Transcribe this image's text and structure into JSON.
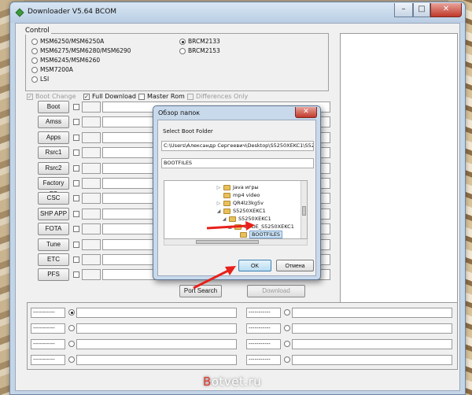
{
  "window": {
    "title": "Downloader V5.64 BCOM",
    "buttons": {
      "minimize": "–",
      "maximize": "□",
      "close": "✕"
    }
  },
  "control": {
    "label": "Control",
    "left_options": [
      "MSM6250/MSM6250A",
      "MSM6275/MSM6280/MSM6290",
      "MSM6245/MSM6260",
      "MSM7200A",
      "LSI"
    ],
    "right_options": [
      "BRCM2133",
      "BRCM2153"
    ],
    "selected": "BRCM2133"
  },
  "options": [
    {
      "label": "Boot Change",
      "checked": true,
      "enabled": false
    },
    {
      "label": "Full Download",
      "checked": true,
      "enabled": true
    },
    {
      "label": "Master Rom",
      "checked": false,
      "enabled": true
    },
    {
      "label": "Differences Only",
      "checked": false,
      "enabled": false
    }
  ],
  "file_buttons": [
    "Boot",
    "Amss",
    "Apps",
    "Rsrc1",
    "Rsrc2",
    "Factory FS",
    "CSC",
    "SHP APP",
    "FOTA",
    "Tune",
    "ETC",
    "PFS"
  ],
  "action_buttons": {
    "port_search": "Port Search",
    "download": "Download"
  },
  "ports": {
    "placeholder": "-----------",
    "rows": 4
  },
  "dialog": {
    "title": "Обзор папок",
    "close": "✕",
    "instruction": "Select Boot Folder",
    "path": "C:\\Users\\Александр Сергеевич\\Desktop\\S5250XEKC1\\S525",
    "folder_field": "BOOTFILES",
    "tree": [
      {
        "label": "Java игры",
        "indent": 0,
        "arrow": "▷"
      },
      {
        "label": "mp4 video",
        "indent": 0,
        "arrow": ""
      },
      {
        "label": "QR4lz3kg5v",
        "indent": 0,
        "arrow": "▷"
      },
      {
        "label": "S5250XEKC1",
        "indent": 0,
        "arrow": "◢"
      },
      {
        "label": "S5250XEKC1",
        "indent": 1,
        "arrow": "◢"
      },
      {
        "label": "CODE_S5250XEKC1",
        "indent": 2,
        "arrow": "◢"
      },
      {
        "label": "BOOTFILES",
        "indent": 3,
        "arrow": "",
        "selected": true
      }
    ],
    "ok_label": "OK",
    "cancel_label": "Отмена"
  },
  "watermark": {
    "first_letter": "B",
    "rest": "otvet.ru"
  },
  "colors": {
    "arrow_red": "#e8201a",
    "selection": "#cce4f7"
  }
}
